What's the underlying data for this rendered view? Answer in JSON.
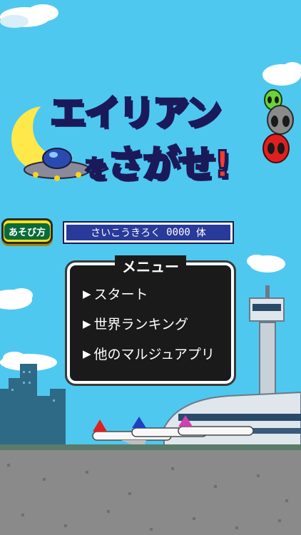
{
  "title": {
    "line1": "エイリアン",
    "particle": "を",
    "line2": "さがせ",
    "bang": "!"
  },
  "hud": {
    "how_to_label": "あそび方",
    "best_label": "さいこうきろく",
    "best_value": "0000",
    "best_unit": "体"
  },
  "menu": {
    "title": "メニュー",
    "items": [
      {
        "label": "スタート"
      },
      {
        "label": "世界ランキング"
      },
      {
        "label": "他のマルジュアプリ"
      }
    ]
  },
  "colors": {
    "sky": "#4fc8f0",
    "ground": "#8a8a8a",
    "menu_bg": "#1a1a1a",
    "record_bg": "#283a9a",
    "button_yellow": "#ffe01a"
  }
}
